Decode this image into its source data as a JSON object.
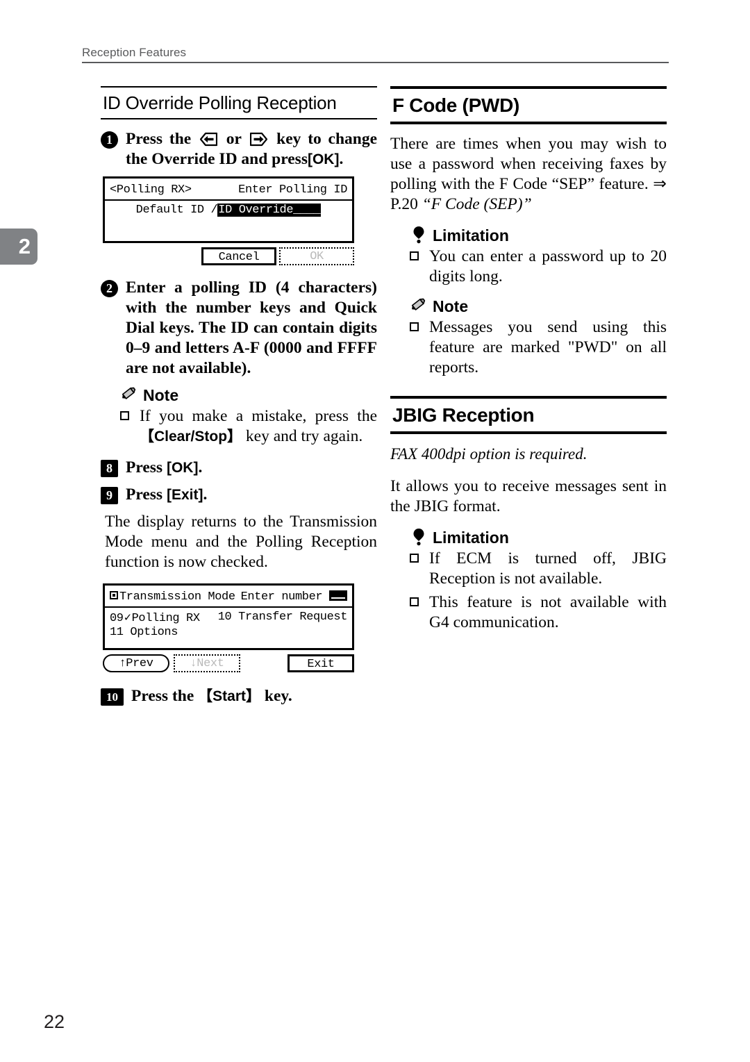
{
  "header": {
    "running_head": "Reception Features",
    "chapter_tab": "2"
  },
  "footer": {
    "page_number": "22"
  },
  "left_column": {
    "section_title": "ID Override Polling Reception",
    "step1": {
      "number": "1",
      "text_a": "Press the",
      "icon_left": "arrow-left-key-icon",
      "text_or": "or",
      "icon_right": "arrow-right-key-icon",
      "text_b": "key to change the Override ID and press",
      "key": "[OK]",
      "text_c": "."
    },
    "lcd1": {
      "title_left": "<Polling RX>",
      "title_right": "Enter Polling ID",
      "line_prefix": "Default ID / ",
      "line_highlight": "ID Override____",
      "button_cancel": "Cancel",
      "button_ok": "OK"
    },
    "step2": {
      "number": "2",
      "text": "Enter a polling ID (4 characters) with the number keys and Quick Dial keys. The ID can contain digits 0–9 and letters A-F (0000 and FFFF are not available)."
    },
    "note1": {
      "icon": "pencil-icon",
      "label": "Note",
      "bullet_a": "If you make a mistake, press the",
      "bullet_key": "【Clear/Stop】",
      "bullet_b": "key and try again."
    },
    "step8": {
      "number": "8",
      "text_a": "Press",
      "key": "[OK]",
      "text_b": "."
    },
    "step9": {
      "number": "9",
      "text_a": "Press",
      "key": "[Exit]",
      "text_b": "."
    },
    "paragraph": "The display returns to the Transmission Mode menu and the Polling Reception function is now checked.",
    "lcd2": {
      "icon": "filled-square-icon",
      "title_left": "Transmission Mode",
      "title_right": "Enter number",
      "cursor": "cursor-block-icon",
      "row1_left_num": "09",
      "row1_left_check": "✓",
      "row1_left_label": "Polling RX",
      "row1_right_num": "10",
      "row1_right_label": "Transfer Request",
      "row2_num": "11",
      "row2_label": "Options",
      "button_prev": "↑Prev",
      "button_next": "↓Next",
      "button_exit": "Exit"
    },
    "step10": {
      "number": "10",
      "text_a": "Press the",
      "key": "【Start】",
      "text_b": "key."
    }
  },
  "right_column": {
    "section1": {
      "title": "F Code (PWD)",
      "paragraph_plain": "There are times when you may wish to use a password when receiving faxes by polling with the F Code “SEP” feature. ⇒ P.20 ",
      "paragraph_italic": "“F Code (SEP)”",
      "limitation": {
        "icon": "exclamation-drop-icon",
        "label": "Limitation",
        "bullets": [
          "You can enter a password up to 20 digits long."
        ]
      },
      "note": {
        "icon": "pencil-icon",
        "label": "Note",
        "bullets": [
          "Messages you send using this feature are marked \"PWD\" on all reports."
        ]
      }
    },
    "section2": {
      "title": "JBIG Reception",
      "italic_line": "FAX 400dpi option is required.",
      "paragraph": "It allows you to receive messages sent in the JBIG format.",
      "limitation": {
        "icon": "exclamation-drop-icon",
        "label": "Limitation",
        "bullets": [
          "If ECM is turned off, JBIG Reception is not available.",
          "This feature is not available with G4 communication."
        ]
      }
    }
  }
}
